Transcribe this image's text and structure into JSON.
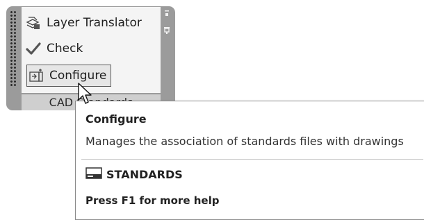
{
  "ribbon_panel": {
    "items": [
      {
        "label": "Layer Translator",
        "icon": "layer-translator-icon"
      },
      {
        "label": "Check",
        "icon": "checkmark-icon"
      },
      {
        "label": "Configure",
        "icon": "configure-icon",
        "selected": true
      }
    ],
    "title": "CAD Standards"
  },
  "tooltip": {
    "title": "Configure",
    "description": "Manages the association of standards files with drawings",
    "command_name": "STANDARDS",
    "help_text": "Press F1 for more help"
  }
}
